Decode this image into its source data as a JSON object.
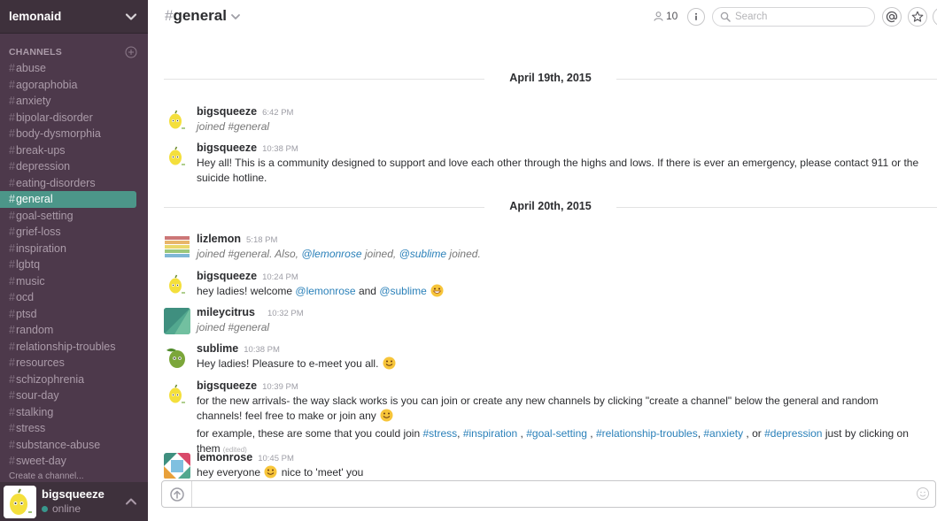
{
  "team": {
    "name": "lemonaid"
  },
  "sidebar": {
    "channels_title": "CHANNELS",
    "channels": [
      {
        "name": "abuse",
        "active": false
      },
      {
        "name": "agoraphobia",
        "active": false
      },
      {
        "name": "anxiety",
        "active": false
      },
      {
        "name": "bipolar-disorder",
        "active": false
      },
      {
        "name": "body-dysmorphia",
        "active": false
      },
      {
        "name": "break-ups",
        "active": false
      },
      {
        "name": "depression",
        "active": false
      },
      {
        "name": "eating-disorders",
        "active": false
      },
      {
        "name": "general",
        "active": true
      },
      {
        "name": "goal-setting",
        "active": false
      },
      {
        "name": "grief-loss",
        "active": false
      },
      {
        "name": "inspiration",
        "active": false
      },
      {
        "name": "lgbtq",
        "active": false
      },
      {
        "name": "music",
        "active": false
      },
      {
        "name": "ocd",
        "active": false
      },
      {
        "name": "ptsd",
        "active": false
      },
      {
        "name": "random",
        "active": false
      },
      {
        "name": "relationship-troubles",
        "active": false
      },
      {
        "name": "resources",
        "active": false
      },
      {
        "name": "schizophrenia",
        "active": false
      },
      {
        "name": "sour-day",
        "active": false
      },
      {
        "name": "stalking",
        "active": false
      },
      {
        "name": "stress",
        "active": false
      },
      {
        "name": "substance-abuse",
        "active": false
      },
      {
        "name": "sweet-day",
        "active": false
      }
    ],
    "create_channel": "Create a channel...",
    "user": {
      "name": "bigsqueeze",
      "status": "online"
    }
  },
  "header": {
    "channel_hash": "#",
    "channel_name": "general",
    "member_count": "10",
    "search_placeholder": "Search"
  },
  "messages": {
    "day1": "April 19th, 2015",
    "day2": "April 20th, 2015",
    "m1": {
      "author": "bigsqueeze",
      "time": "6:42 PM",
      "text": "joined #general"
    },
    "m2": {
      "author": "bigsqueeze",
      "time": "10:38 PM",
      "text": "Hey all! This is a community designed to support and love each other through the highs and lows. If there is ever an emergency, please contact 911 or the suicide hotline."
    },
    "m3": {
      "author": "lizlemon",
      "time": "5:18 PM",
      "text_a": "joined #general. Also, ",
      "mention1": "@lemonrose",
      "text_b": " joined, ",
      "mention2": "@sublime",
      "text_c": " joined."
    },
    "m4": {
      "author": "bigsqueeze",
      "time": "10:24 PM",
      "text_a": "hey ladies! welcome ",
      "mention1": "@lemonrose",
      "text_b": " and ",
      "mention2": "@sublime"
    },
    "m5": {
      "author": "mileycitrus",
      "time": "10:32 PM",
      "text": "joined #general"
    },
    "m6": {
      "author": "sublime",
      "time": "10:38 PM",
      "text": "Hey ladies! Pleasure to e-meet you all."
    },
    "m7": {
      "author": "bigsqueeze",
      "time": "10:39 PM",
      "text": "for the new arrivals- the way slack works is you can join or create any new channels by clicking \"create a channel\" below the general and random channels! feel free to make or join any",
      "text2_a": "for example, these are some that you could join ",
      "links": [
        "#stress",
        "#inspiration",
        "#goal-setting",
        "#relationship-troubles",
        "#anxiety",
        "#depression"
      ],
      "sep1": ", ",
      "sep2": " , ",
      "sep3": " , ",
      "sep4": ", ",
      "sep5": " , or ",
      "text2_b": " just by clicking on them",
      "edited": "(edited)"
    },
    "m8": {
      "author": "lemonrose",
      "time": "10:45 PM",
      "text_a": "hey everyone ",
      "text_b": " nice to 'meet' you"
    }
  },
  "colors": {
    "sidebar_bg": "#4d394b",
    "sidebar_header_bg": "#3e313c",
    "active_channel": "#4c9689",
    "link": "#2a80b9",
    "presence": "#38978d"
  },
  "icons": [
    "chevron-down-icon",
    "add-channel-icon",
    "person-icon",
    "info-icon",
    "search-icon",
    "at-icon",
    "star-icon",
    "upload-icon",
    "emoji-icon"
  ]
}
